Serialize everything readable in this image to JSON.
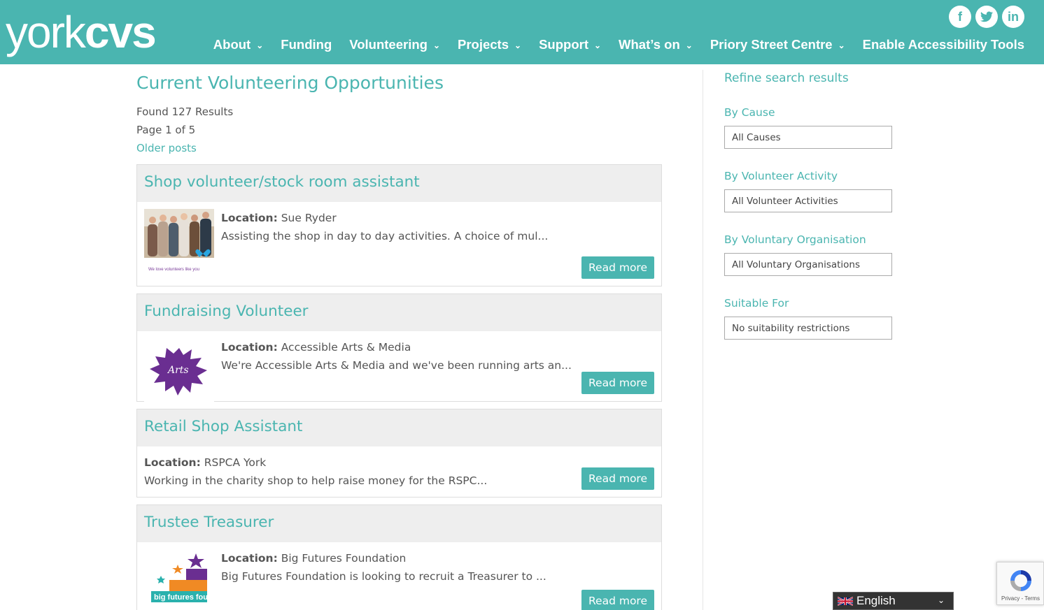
{
  "header": {
    "logo_light": "york",
    "logo_bold": "cvs",
    "social": [
      {
        "name": "facebook",
        "glyph": "f"
      },
      {
        "name": "twitter",
        "glyph": "t"
      },
      {
        "name": "linkedin",
        "glyph": "in"
      }
    ],
    "nav": [
      {
        "label": "About",
        "dropdown": true
      },
      {
        "label": "Funding",
        "dropdown": false
      },
      {
        "label": "Volunteering",
        "dropdown": true
      },
      {
        "label": "Projects",
        "dropdown": true
      },
      {
        "label": "Support",
        "dropdown": true
      },
      {
        "label": "What’s on",
        "dropdown": true
      },
      {
        "label": "Priory Street Centre",
        "dropdown": true
      },
      {
        "label": "Enable Accessibility Tools",
        "dropdown": false
      }
    ]
  },
  "main": {
    "title": "Current Volunteering Opportunities",
    "found": "Found 127 Results",
    "page": "Page 1 of 5",
    "older": "Older posts",
    "location_label": "Location:",
    "read_more": "Read more",
    "listings": [
      {
        "title": "Shop volunteer/stock room assistant",
        "location": "Sue Ryder",
        "summary": "Assisting the shop in day to day activities. A choice of mul...",
        "image": "sue-ryder-volunteers-photo",
        "image_caption": "We love volunteers like you"
      },
      {
        "title": "Fundraising Volunteer",
        "location": "Accessible Arts & Media",
        "summary": "We're Accessible Arts & Media and we've been running arts an...",
        "image": "accessible-arts-logo",
        "image_caption": "Arts"
      },
      {
        "title": "Retail Shop Assistant",
        "location": "RSPCA York",
        "summary": "Working in the charity shop to help raise money for the RSPC...",
        "image": null
      },
      {
        "title": "Trustee Treasurer",
        "location": "Big Futures Foundation",
        "summary": "Big Futures Foundation is looking to recruit a Treasurer to ...",
        "image": "big-futures-logo",
        "image_caption": "big futures foundation"
      }
    ]
  },
  "sidebar": {
    "title": "Refine search results",
    "filters": [
      {
        "label": "By Cause",
        "value": "All Causes"
      },
      {
        "label": "By Volunteer Activity",
        "value": "All Volunteer Activities"
      },
      {
        "label": "By Voluntary Organisation",
        "value": "All Voluntary Organisations"
      },
      {
        "label": "Suitable For",
        "value": "No suitability restrictions"
      }
    ]
  },
  "translate": {
    "language": "English"
  },
  "recaptcha": {
    "text": "Privacy - Terms"
  },
  "colors": {
    "brand": "#4ab5b0",
    "card_header": "#eeeeee"
  }
}
